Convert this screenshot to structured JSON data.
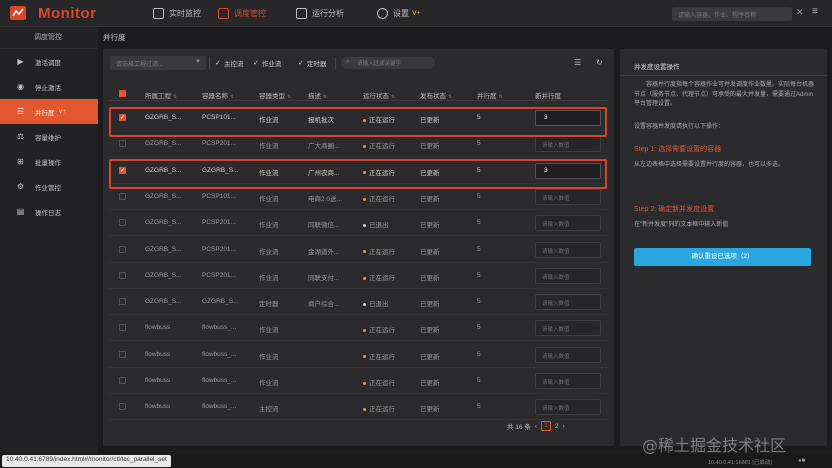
{
  "topbar": {
    "brand": "Monitor",
    "nav": [
      {
        "label": "实时监控",
        "icon": "monitor-icon"
      },
      {
        "label": "调度管控",
        "icon": "schedule-icon"
      },
      {
        "label": "运行分析",
        "icon": "analysis-icon"
      },
      {
        "label": "设置",
        "icon": "gear-icon",
        "badge": "V+"
      }
    ],
    "search_placeholder": "请输入容器、作业、程序名称",
    "close": "✕",
    "menu": "≡"
  },
  "sidebar": {
    "title": "调度管控",
    "items": [
      {
        "label": "激活调度",
        "icon": "play-icon"
      },
      {
        "label": "停止激活",
        "icon": "stop-circle-icon"
      },
      {
        "label": "并行度",
        "icon": "list-icon",
        "badge": "V+"
      },
      {
        "label": "容量维护",
        "icon": "capacity-icon"
      },
      {
        "label": "批量操作",
        "icon": "batch-icon"
      },
      {
        "label": "作业管控",
        "icon": "job-icon"
      },
      {
        "label": "操作日志",
        "icon": "log-icon"
      }
    ]
  },
  "page_title": "并行度",
  "filters": {
    "project_placeholder": "请选择工程过滤...",
    "options": [
      "主控流",
      "作业流",
      "定时器"
    ],
    "search_placeholder": "请输入过滤关键字"
  },
  "table": {
    "headers": [
      "所属工程",
      "容器名称",
      "容器类型",
      "描述",
      "运行状态",
      "发布状态",
      "并行度",
      "新并行度"
    ],
    "input_placeholder": "请输入数值",
    "rows": [
      {
        "project": "GZGRB_S...",
        "container": "PCSP101...",
        "type": "作业流",
        "desc": "报机批次",
        "run": "正在运行",
        "run_state": "run",
        "pub": "已更新",
        "parallel": "5",
        "new": "3",
        "checked": true
      },
      {
        "project": "GZGRB_S...",
        "container": "PCSP201...",
        "type": "作业流",
        "desc": "广大商圈...",
        "run": "正在运行",
        "run_state": "run",
        "pub": "已更新",
        "parallel": "5",
        "new": "",
        "checked": false
      },
      {
        "project": "GZGRB_S...",
        "container": "GZGRB_S...",
        "type": "作业流",
        "desc": "广州农商...",
        "run": "正在运行",
        "run_state": "run",
        "pub": "已更新",
        "parallel": "5",
        "new": "3",
        "checked": true
      },
      {
        "project": "GZGRB_S...",
        "container": "PCSP101...",
        "type": "作业流",
        "desc": "电商2.0送...",
        "run": "正在运行",
        "run_state": "run",
        "pub": "已更新",
        "parallel": "5",
        "new": "",
        "checked": false
      },
      {
        "project": "GZGRB_S...",
        "container": "PCSP201...",
        "type": "作业流",
        "desc": "同联微信...",
        "run": "已退出",
        "run_state": "off",
        "pub": "已更新",
        "parallel": "5",
        "new": "",
        "checked": false
      },
      {
        "project": "GZGRB_S...",
        "container": "PCSP201...",
        "type": "作业流",
        "desc": "金湖道外...",
        "run": "正在运行",
        "run_state": "run",
        "pub": "已更新",
        "parallel": "5",
        "new": "",
        "checked": false
      },
      {
        "project": "GZGRB_S...",
        "container": "PCSP201...",
        "type": "作业流",
        "desc": "同联支付...",
        "run": "正在运行",
        "run_state": "run",
        "pub": "已更新",
        "parallel": "5",
        "new": "",
        "checked": false
      },
      {
        "project": "GZGRB_S...",
        "container": "GZGRB_S...",
        "type": "定时器",
        "desc": "商户综合...",
        "run": "已退出",
        "run_state": "off",
        "pub": "已更新",
        "parallel": "5",
        "new": "",
        "checked": false
      },
      {
        "project": "flowbuss",
        "container": "flowbuss_...",
        "type": "作业流",
        "desc": "",
        "run": "正在运行",
        "run_state": "run",
        "pub": "已更新",
        "parallel": "5",
        "new": "",
        "checked": false
      },
      {
        "project": "flowbuss",
        "container": "flowbuss_...",
        "type": "作业流",
        "desc": "",
        "run": "正在运行",
        "run_state": "run",
        "pub": "已更新",
        "parallel": "5",
        "new": "",
        "checked": false
      },
      {
        "project": "flowbuss",
        "container": "flowbuss_...",
        "type": "作业流",
        "desc": "",
        "run": "正在运行",
        "run_state": "run",
        "pub": "已更新",
        "parallel": "5",
        "new": "",
        "checked": false
      },
      {
        "project": "flowbuss",
        "container": "flowbuss_...",
        "type": "主控流",
        "desc": "",
        "run": "正在运行",
        "run_state": "run",
        "pub": "已更新",
        "parallel": "5",
        "new": "",
        "checked": false
      }
    ]
  },
  "pager": {
    "total": "共 16 条",
    "prev": "‹",
    "pages": [
      "1",
      "2"
    ],
    "next": "›"
  },
  "help": {
    "title": "并发度设置操作",
    "intro": "容器并行度指每个容器作业可并发调度作业数量。实际每台机器节点（服务节点、代理节点）可承受的最大并发量，需要通过Admin平台管理设置。",
    "steps_label": "设置容器并发度请执行以下操作：",
    "step1": "Step 1: 选择需要设置的容器",
    "step1_text": "从左边表格中选择需要设置并行度的容器，也可以多选。",
    "step2": "Step 2: 确定新并发度设置",
    "step2_text": "在\"新并发度\"列的文本框中输入新值",
    "confirm": "确认重设已选项（2）"
  },
  "watermark": "@稀土掘金技术社区",
  "status": {
    "url": "10.40.0.41:6789/index.html#/monitor/ctl/tcc_parallel_set",
    "right": "10.40.0.41:16881 [已启动]"
  },
  "colors": {
    "accent": "#e2572e",
    "confirm": "#2aa7e0",
    "highlight": "#d9432b",
    "running": "#e0a23b"
  }
}
